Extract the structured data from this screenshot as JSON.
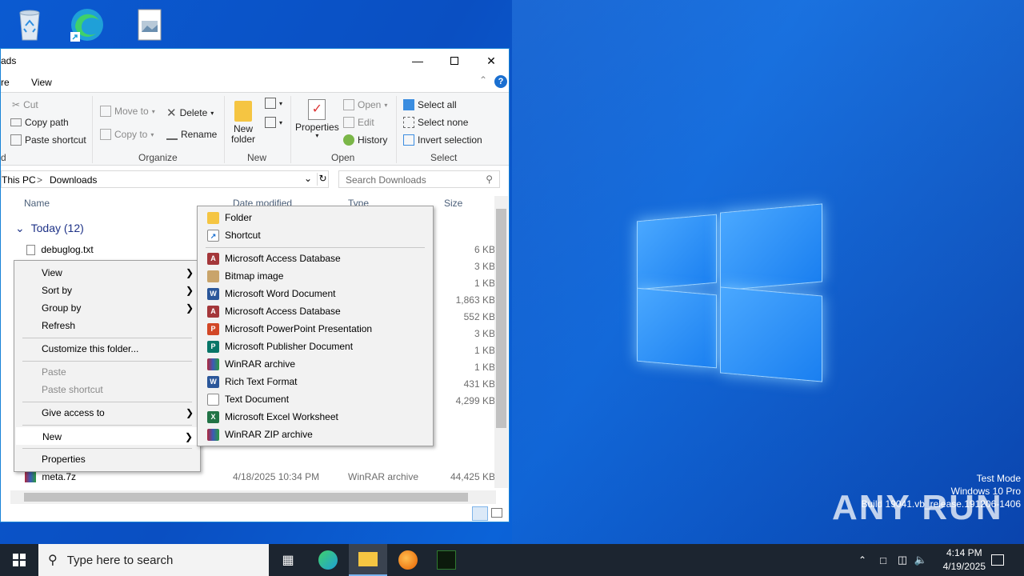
{
  "explorer": {
    "title_partial": "ads",
    "ribbon_tabs": [
      "re",
      "View"
    ],
    "clipboard": {
      "cut": "Cut",
      "copy_path": "Copy path",
      "paste_shortcut": "Paste shortcut",
      "group_partial": "d"
    },
    "organize": {
      "move_to": "Move to",
      "copy_to": "Copy to",
      "delete": "Delete",
      "rename": "Rename",
      "group": "Organize"
    },
    "new": {
      "new_folder_l1": "New",
      "new_folder_l2": "folder",
      "group": "New"
    },
    "open": {
      "properties": "Properties",
      "open": "Open",
      "edit": "Edit",
      "history": "History",
      "group": "Open"
    },
    "select": {
      "select_all": "Select all",
      "select_none": "Select none",
      "invert": "Invert selection",
      "group": "Select"
    },
    "address": {
      "this_pc": "This PC",
      "sep": ">",
      "folder": "Downloads"
    },
    "search_placeholder": "Search Downloads",
    "columns": {
      "name": "Name",
      "date": "Date modified",
      "type": "Type",
      "size": "Size"
    },
    "group_header": "Today (12)",
    "rows": [
      {
        "name": "debuglog.txt",
        "date": "",
        "type": "",
        "size": "6 KB"
      },
      {
        "name": "meta.7z",
        "date": "4/18/2025 10:34 PM",
        "type": "WinRAR archive",
        "size": "44,425 KB"
      }
    ],
    "sizes": [
      "3 KB",
      "1 KB",
      "1,863 KB",
      "552 KB",
      "3 KB",
      "1 KB",
      "1 KB",
      "431 KB",
      "4,299 KB"
    ]
  },
  "context_menu": {
    "items": [
      {
        "label": "View",
        "submenu": true,
        "disabled": false
      },
      {
        "label": "Sort by",
        "submenu": true,
        "disabled": false
      },
      {
        "label": "Group by",
        "submenu": true,
        "disabled": false
      },
      {
        "label": "Refresh",
        "submenu": false,
        "disabled": false
      },
      {
        "label": "Customize this folder...",
        "submenu": false,
        "disabled": false
      },
      {
        "label": "Paste",
        "submenu": false,
        "disabled": true
      },
      {
        "label": "Paste shortcut",
        "submenu": false,
        "disabled": true
      },
      {
        "label": "Give access to",
        "submenu": true,
        "disabled": false
      },
      {
        "label": "New",
        "submenu": true,
        "disabled": false
      },
      {
        "label": "Properties",
        "submenu": false,
        "disabled": false
      }
    ]
  },
  "new_submenu": {
    "items": [
      {
        "label": "Folder",
        "icon": "folder-icon"
      },
      {
        "label": "Shortcut",
        "icon": "shortcut-icon"
      },
      {
        "label": "Microsoft Access Database",
        "icon": "access-icon"
      },
      {
        "label": "Bitmap image",
        "icon": "bitmap-icon"
      },
      {
        "label": "Microsoft Word Document",
        "icon": "word-icon"
      },
      {
        "label": "Microsoft Access Database",
        "icon": "access-icon"
      },
      {
        "label": "Microsoft PowerPoint Presentation",
        "icon": "powerpoint-icon"
      },
      {
        "label": "Microsoft Publisher Document",
        "icon": "publisher-icon"
      },
      {
        "label": "WinRAR archive",
        "icon": "winrar-icon"
      },
      {
        "label": "Rich Text Format",
        "icon": "rtf-icon"
      },
      {
        "label": "Text Document",
        "icon": "text-icon"
      },
      {
        "label": "Microsoft Excel Worksheet",
        "icon": "excel-icon"
      },
      {
        "label": "WinRAR ZIP archive",
        "icon": "winrar-zip-icon"
      }
    ]
  },
  "desktop": {
    "watermark": {
      "line1": "Test Mode",
      "line2": "Windows 10 Pro",
      "line3": "Build 19041.vb_release.191206-1406"
    },
    "logo_text": "ANY RUN"
  },
  "taskbar": {
    "search_placeholder": "Type here to search",
    "time": "4:14 PM",
    "date": "4/19/2025"
  },
  "colors": {
    "accent": "#0078d7",
    "taskbar": "#1c2530",
    "menu_bg": "#f2f2f2"
  }
}
